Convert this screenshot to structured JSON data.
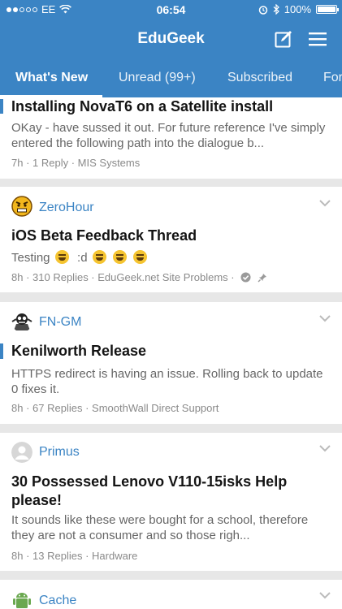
{
  "status": {
    "carrier": "EE",
    "time": "06:54",
    "battery": "100%",
    "battery_level": 1.0
  },
  "header": {
    "title": "EduGeek"
  },
  "tabs": [
    "What's New",
    "Unread (99+)",
    "Subscribed",
    "For"
  ],
  "threads": [
    {
      "title": "Installing NovaT6 on a Satellite install",
      "snippet": "OKay - have sussed it out. For future reference I've simply entered the following path into the dialogue b...",
      "time": "7h",
      "replies": "1 Reply",
      "forum": "MIS Systems"
    },
    {
      "author": "ZeroHour",
      "avatar_icon": "angry-face-icon",
      "title": "iOS Beta Feedback Thread",
      "snippet_text": "Testing",
      "snippet_mid": ":d",
      "time": "8h",
      "replies": "310 Replies",
      "forum": "EduGeek.net Site Problems"
    },
    {
      "author": "FN-GM",
      "avatar_icon": "robot-icon",
      "title": "Kenilworth Release",
      "snippet": "HTTPS redirect is having an issue. Rolling back to update 0 fixes it.",
      "time": "8h",
      "replies": "67 Replies",
      "forum": "SmoothWall Direct Support"
    },
    {
      "author": "Primus",
      "avatar_icon": "default-user-icon",
      "title": "30 Possessed Lenovo V110-15isks Help please!",
      "snippet": "It sounds like these were bought for a school, therefore they are not a consumer and so those righ...",
      "time": "8h",
      "replies": "13 Replies",
      "forum": "Hardware"
    },
    {
      "author": "Cache",
      "avatar_icon": "android-icon"
    }
  ],
  "colors": {
    "brand": "#3b84c4",
    "author": "#3b84c4"
  }
}
